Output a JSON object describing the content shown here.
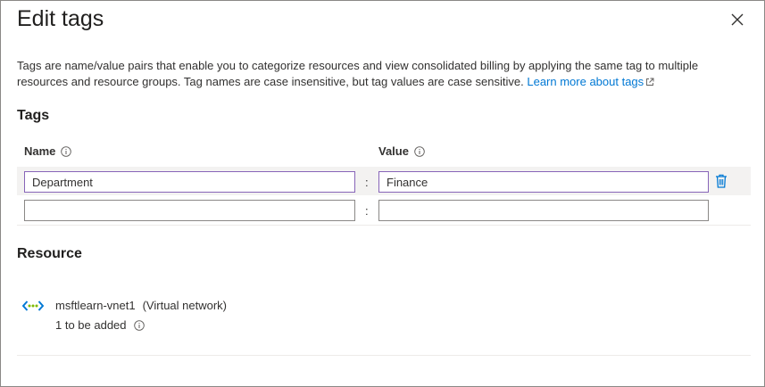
{
  "dialog": {
    "title": "Edit tags",
    "description": "Tags are name/value pairs that enable you to categorize resources and view consolidated billing by applying the same tag to multiple resources and resource groups. Tag names are case insensitive, but tag values are case sensitive.",
    "learn_more_link": "Learn more about tags"
  },
  "tags_section": {
    "title": "Tags",
    "name_header": "Name",
    "value_header": "Value",
    "separator": ":",
    "rows": [
      {
        "name": "Department",
        "value": "Finance"
      },
      {
        "name": "",
        "value": ""
      }
    ]
  },
  "resource_section": {
    "title": "Resource",
    "resource_name": "msftlearn-vnet1",
    "resource_type": "(Virtual network)",
    "status": "1 to be added"
  },
  "icons": {
    "close": "close-icon",
    "info": "info-icon",
    "external_link": "external-link-icon",
    "delete": "trash-icon",
    "resource": "virtual-network-icon"
  },
  "colors": {
    "accent": "#0078d4",
    "focus_border": "#8764b8",
    "row_highlight": "#f3f2f1",
    "vnet_green": "#7fba00"
  }
}
